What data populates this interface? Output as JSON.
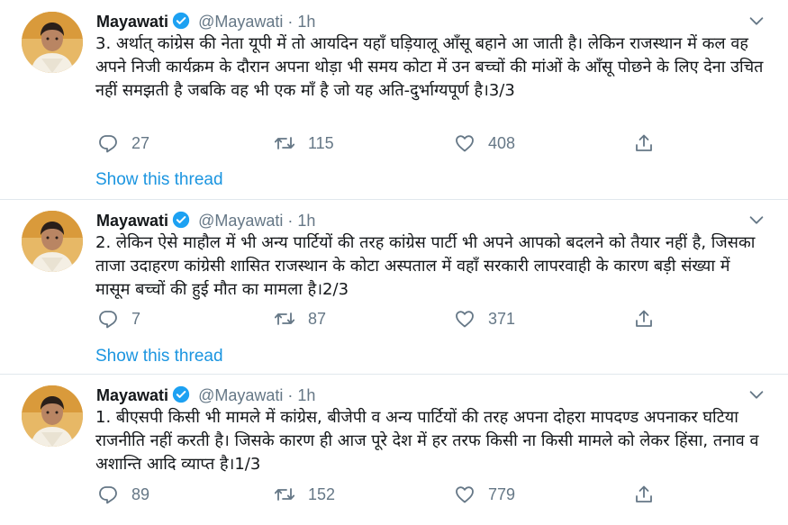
{
  "tweets": [
    {
      "author": "Mayawati",
      "handle": "@Mayawati",
      "separator": "·",
      "time": "1h",
      "text": "3. अर्थात् कांग्रेस की नेता यूपी में तो आयदिन यहाँ घड़ियालू आँसू बहाने आ जाती है। लेकिन राजस्थान में कल वह अपने निजी कार्यक्रम के दौरान अपना थोड़ा भी समय कोटा में उन बच्चों की मांओं के आँसू पोछने के लिए देना उचित नहीं समझती है जबकि वह भी एक माँ है जो यह अति-दुर्भाग्यपूर्ण है।3/3",
      "replies": "27",
      "retweets": "115",
      "likes": "408",
      "show_thread": "Show this thread"
    },
    {
      "author": "Mayawati",
      "handle": "@Mayawati",
      "separator": "·",
      "time": "1h",
      "text": "2. लेकिन ऐसे माहौल में भी अन्य पार्टियों की तरह कांग्रेस पार्टी भी अपने आपको बदलने को तैयार नहीं है, जिसका ताजा उदाहरण कांग्रेसी शासित राजस्थान के कोटा अस्पताल में वहाँ सरकारी लापरवाही के कारण बड़ी संख्या में मासूम बच्चों की हुई मौत का मामला है।2/3",
      "replies": "7",
      "retweets": "87",
      "likes": "371",
      "show_thread": "Show this thread"
    },
    {
      "author": "Mayawati",
      "handle": "@Mayawati",
      "separator": "·",
      "time": "1h",
      "text": "1. बीएसपी किसी भी मामले में कांग्रेस, बीजेपी व अन्य पार्टियों की तरह अपना दोहरा मापदण्ड अपनाकर घटिया राजनीति नहीं करती है। जिसके कारण ही आज पूरे देश में हर तरफ किसी ना किसी मामले को लेकर हिंसा, तनाव व अशान्ति आदि व्याप्त है।1/3",
      "replies": "89",
      "retweets": "152",
      "likes": "779"
    }
  ],
  "colors": {
    "link": "#1b95e0",
    "muted": "#657786",
    "verified": "#1da1f2",
    "divider": "#e1e8ed"
  },
  "icons": [
    "verified-badge-icon",
    "chevron-down-icon",
    "reply-icon",
    "retweet-icon",
    "like-icon",
    "share-icon"
  ]
}
